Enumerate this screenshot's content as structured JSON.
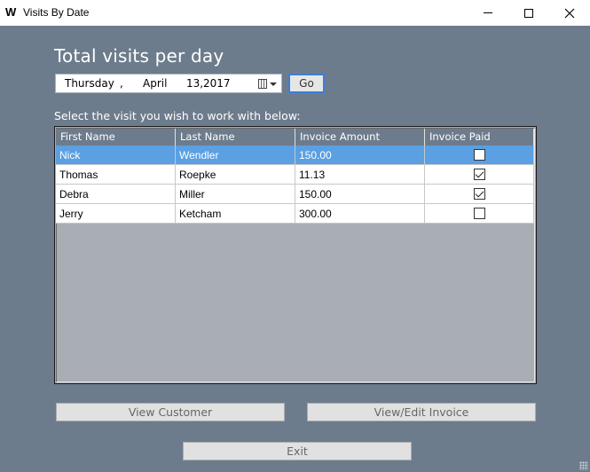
{
  "window": {
    "app_icon_letter": "W",
    "title": "Visits By Date",
    "controls": [
      "minimize",
      "maximize",
      "close"
    ]
  },
  "heading": "Total visits per day",
  "date_picker": {
    "day": "Thursday",
    "comma": ",",
    "month": "April",
    "date": "13,",
    "year": "2017",
    "icon": "calendar-icon"
  },
  "go_button": "Go",
  "subtitle": "Select the visit you wish to work with below:",
  "grid": {
    "columns": [
      "First Name",
      "Last Name",
      "Invoice Amount",
      "Invoice Paid"
    ],
    "rows": [
      {
        "first": "Nick",
        "last": "Wendler",
        "amount": "150.00",
        "paid": false,
        "selected": true
      },
      {
        "first": "Thomas",
        "last": "Roepke",
        "amount": "11.13",
        "paid": true,
        "selected": false
      },
      {
        "first": "Debra",
        "last": "Miller",
        "amount": "150.00",
        "paid": true,
        "selected": false
      },
      {
        "first": "Jerry",
        "last": "Ketcham",
        "amount": "300.00",
        "paid": false,
        "selected": false
      }
    ]
  },
  "buttons": {
    "view_customer": "View Customer",
    "view_edit_invoice": "View/Edit Invoice",
    "exit": "Exit"
  },
  "colors": {
    "background": "#6d7c8c",
    "selection": "#5aa0e2",
    "accent_border": "#3c7fd6"
  }
}
